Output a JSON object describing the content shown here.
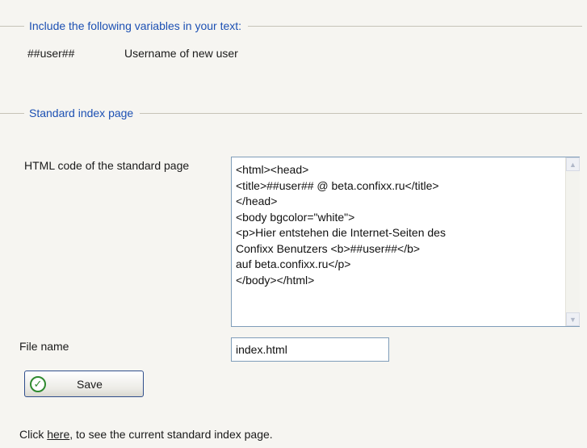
{
  "variables_section": {
    "legend": "Include the following variables in your text:",
    "items": [
      {
        "name": "##user##",
        "description": "Username of new user"
      }
    ]
  },
  "index_section": {
    "legend": "Standard index page",
    "html_code_label": "HTML code of the standard page",
    "html_code_value": "<html><head>\n<title>##user## @ beta.confixx.ru</title>\n</head>\n<body bgcolor=\"white\">\n<p>Hier entstehen die Internet-Seiten des\nConfixx Benutzers <b>##user##</b>\nauf beta.confixx.ru</p>\n</body></html>",
    "file_name_label": "File name",
    "file_name_value": "index.html",
    "save_label": "Save"
  },
  "footer": {
    "prefix": "Click ",
    "link": "here",
    "suffix": ", to see the current standard index page."
  },
  "icons": {
    "save": "check-circle-icon",
    "scroll_up": "scroll-up-arrow-icon",
    "scroll_down": "scroll-down-arrow-icon"
  },
  "colors": {
    "legend": "#1c50b3",
    "background": "#f6f5f1",
    "border": "#7f9db9",
    "check": "#2f8a2f"
  }
}
